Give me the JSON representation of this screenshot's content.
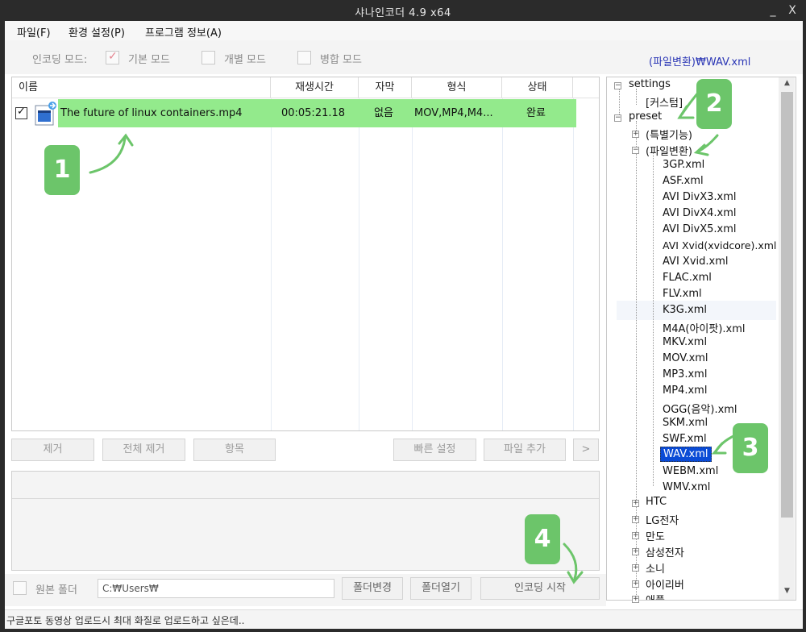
{
  "window": {
    "title": "샤나인코더 4.9 x64",
    "minimize": "_",
    "close": "X"
  },
  "menu": {
    "file": "파일(F)",
    "settings": "환경 설정(P)",
    "info": "프로그램 정보(A)"
  },
  "encoding_mode": {
    "label": "인코딩 모드:",
    "options": [
      {
        "label": "기본 모드",
        "checked": true
      },
      {
        "label": "개별 모드",
        "checked": false
      },
      {
        "label": "병합 모드",
        "checked": false
      }
    ]
  },
  "selected_preset": "(파일변환)₩WAV.xml",
  "file_list": {
    "headers": {
      "name": "이름",
      "duration": "재생시간",
      "subtitle": "자막",
      "format": "형식",
      "status": "상태"
    },
    "rows": [
      {
        "checked": true,
        "name": "The future of linux containers.mp4",
        "duration": "00:05:21.18",
        "subtitle": "없음",
        "format": "MOV,MP4,M4...",
        "status": "완료"
      }
    ]
  },
  "buttons": {
    "remove": "제거",
    "remove_all": "전체 제거",
    "item": "항목",
    "quick_settings": "빠른 설정",
    "add_file": "파일 추가",
    "more": ">",
    "change_folder": "폴더변경",
    "open_folder": "폴더열기",
    "start_encoding": "인코딩 시작"
  },
  "output": {
    "source_folder_label": "원본 폴더",
    "path": "C:₩Users₩"
  },
  "status_text": "구글포토 동영상 업로드시 최대 화질로 업로드하고 싶은데..",
  "tree": {
    "settings": "settings",
    "custom": "[커스텀]",
    "preset": "preset",
    "special": "(특별기능)",
    "convert": "(파일변환)",
    "files": [
      "3GP.xml",
      "ASF.xml",
      "AVI DivX3.xml",
      "AVI DivX4.xml",
      "AVI DivX5.xml",
      "AVI Xvid(xvidcore).xml",
      "AVI Xvid.xml",
      "FLAC.xml",
      "FLV.xml",
      "K3G.xml",
      "M4A(아이팟).xml",
      "MKV.xml",
      "MOV.xml",
      "MP3.xml",
      "MP4.xml",
      "OGG(음악).xml",
      "SKM.xml",
      "SWF.xml",
      "WAV.xml",
      "WEBM.xml",
      "WMV.xml"
    ],
    "selected": "WAV.xml",
    "vendors": [
      "HTC",
      "LG전자",
      "만도",
      "삼성전자",
      "소니",
      "아이리버",
      "애플"
    ]
  },
  "callouts": [
    "1",
    "2",
    "3",
    "4"
  ],
  "colors": {
    "row_highlight": "#93ea8c",
    "callout": "#6cc56a",
    "selected": "#0a4bd6",
    "preset_text": "#2a36b5"
  }
}
